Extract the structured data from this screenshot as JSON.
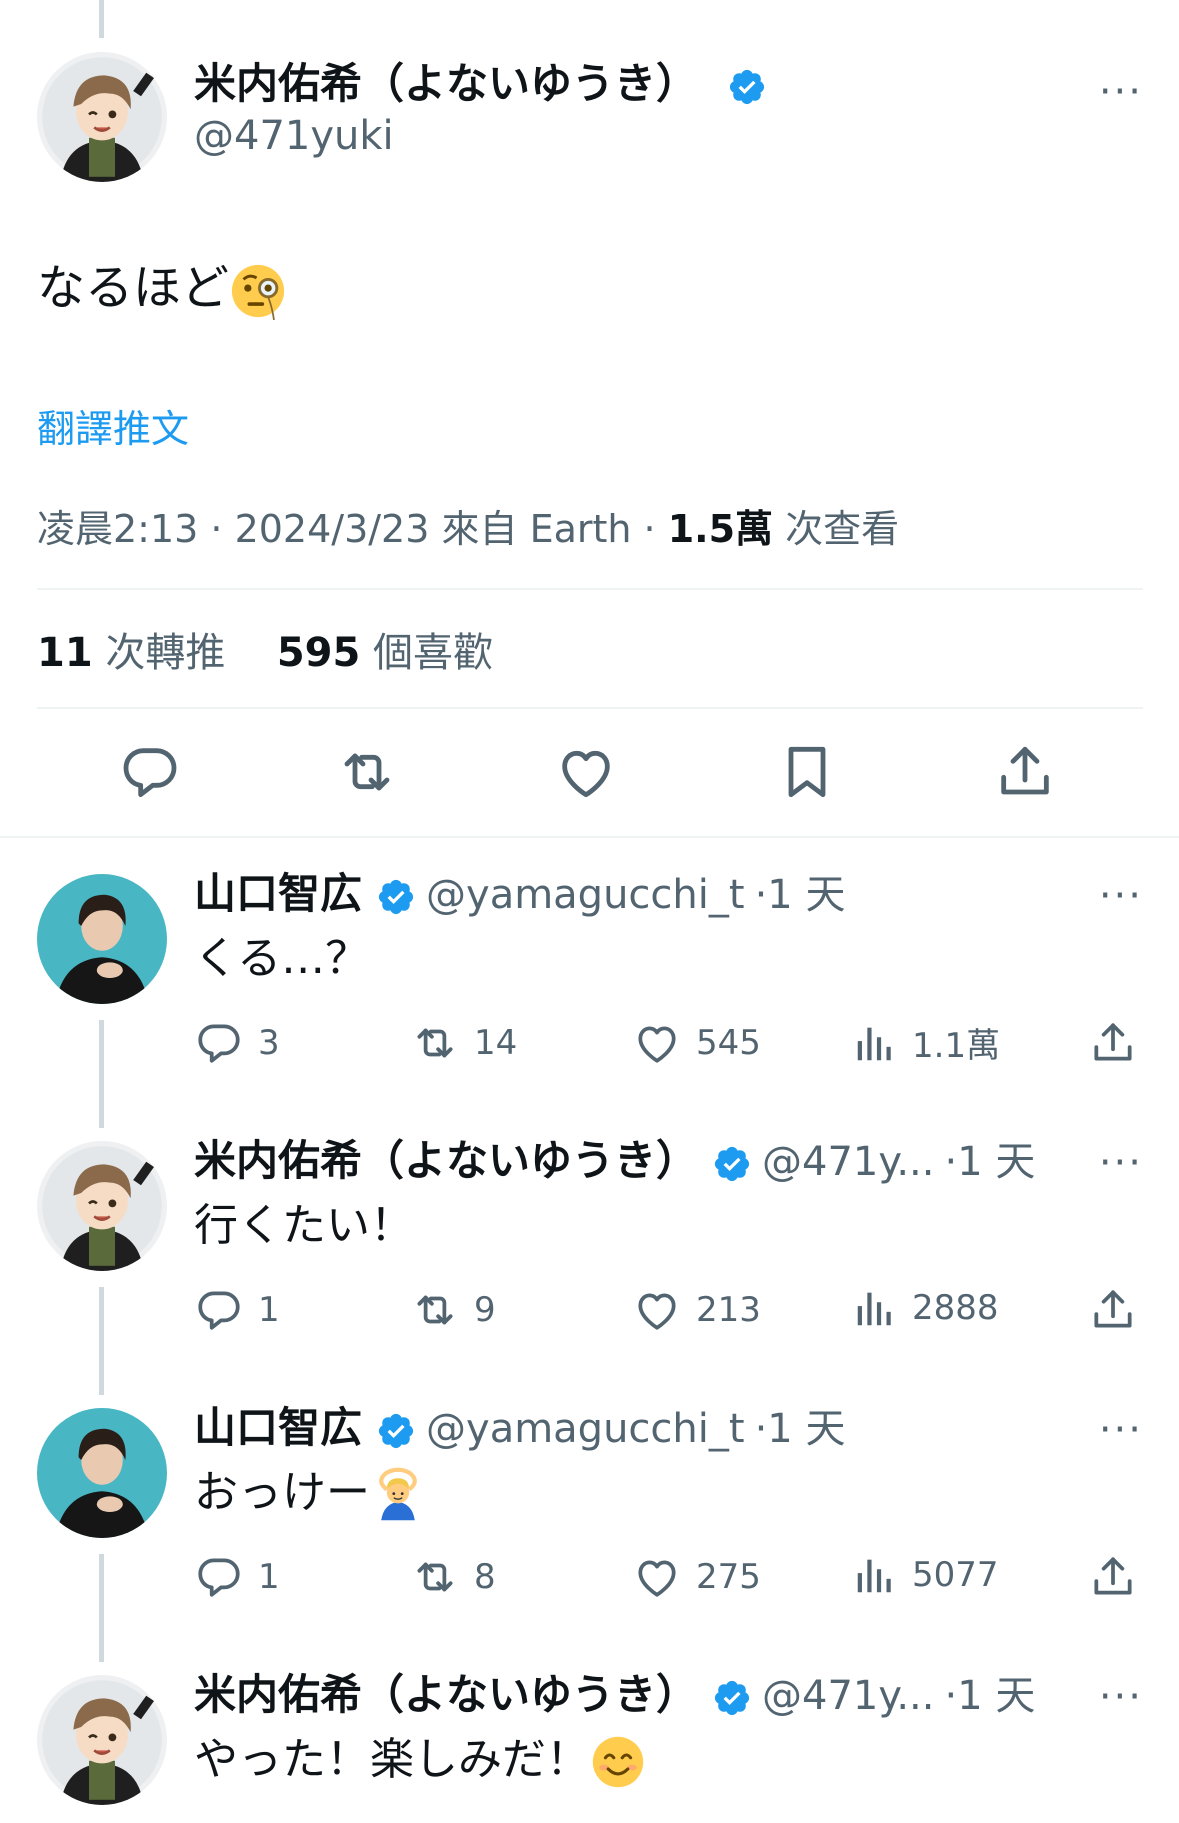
{
  "main_tweet": {
    "author_name": "米内佑希（よないゆうき）",
    "author_handle": "@471yuki",
    "more": "···",
    "text": "なるほど",
    "text_emoji": "face-with-monocle-emoji",
    "translate_label": "翻譯推文",
    "time": "凌晨2:13 · 2024/3/23 來自 Earth · ",
    "views_count": "1.5萬",
    "views_label": " 次查看",
    "retweets_count": "11",
    "retweets_label": " 次轉推",
    "likes_count": "595",
    "likes_label": " 個喜歡"
  },
  "replies": [
    {
      "author_name": "山口智広",
      "author_handle": "@yamagucchi_t",
      "time": "·1 天",
      "text": "くる…？",
      "replies": "3",
      "retweets": "14",
      "likes": "545",
      "views": "1.1萬",
      "avatar": "yamaguchi"
    },
    {
      "author_name": "米内佑希（よないゆうき）",
      "author_handle": "@471y...",
      "time": "·1 天",
      "text": "行くたい！",
      "replies": "1",
      "retweets": "9",
      "likes": "213",
      "views": "2888",
      "avatar": "yonai"
    },
    {
      "author_name": "山口智広",
      "author_handle": "@yamagucchi_t",
      "time": "·1 天",
      "text": "おっけー",
      "text_emoji": "person-gesturing-ok-emoji",
      "replies": "1",
      "retweets": "8",
      "likes": "275",
      "views": "5077",
      "avatar": "yamaguchi"
    },
    {
      "author_name": "米内佑希（よないゆうき）",
      "author_handle": "@471y...",
      "time": "·1 天",
      "text": "やった！楽しみだ！",
      "text_emoji": "smiling-face-emoji",
      "avatar": "yonai"
    }
  ],
  "colors": {
    "accent": "#1d9bf0",
    "secondary_text": "#536471",
    "divider": "#eff3f4",
    "thread_line": "#cfd9de"
  }
}
